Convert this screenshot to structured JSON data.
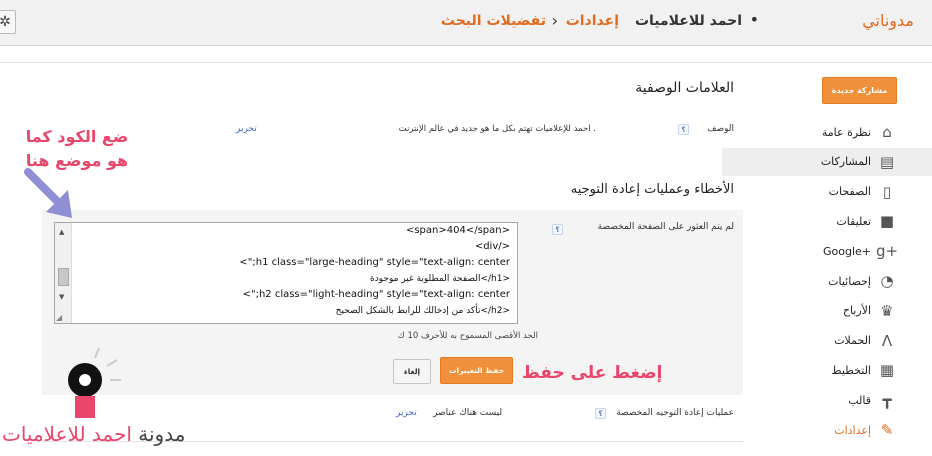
{
  "topbar": {
    "blog_name": "مدوناتي",
    "breadcrumb_blog": "احمد للاعلاميات",
    "breadcrumb_dot": "•",
    "breadcrumb_settings": "إعدادات",
    "breadcrumb_sep": "›",
    "breadcrumb_page": "تفضيلات البحث",
    "gear_icon": "gear-icon"
  },
  "sidebar": {
    "new_post": "مشاركة جديدة",
    "items": [
      {
        "label": "نظرة عامة",
        "icon": "home-icon",
        "glyph": "⌂"
      },
      {
        "label": "المشاركات",
        "icon": "document-icon",
        "glyph": "▤"
      },
      {
        "label": "الصفحات",
        "icon": "page-icon",
        "glyph": "▯"
      },
      {
        "label": "تعليقات",
        "icon": "comment-icon",
        "glyph": "■"
      },
      {
        "label": "Google+",
        "icon": "google-plus-icon",
        "glyph": "g+"
      },
      {
        "label": "إحصائيات",
        "icon": "pie-chart-icon",
        "glyph": "◔"
      },
      {
        "label": "الأرباح",
        "icon": "trophy-icon",
        "glyph": "♛"
      },
      {
        "label": "الحملات",
        "icon": "ads-icon",
        "glyph": "Λ"
      },
      {
        "label": "التخطيط",
        "icon": "layout-icon",
        "glyph": "▦"
      },
      {
        "label": "قالب",
        "icon": "paint-roller-icon",
        "glyph": "┳"
      },
      {
        "label": "إعدادات",
        "icon": "wrench-icon",
        "glyph": "✎"
      }
    ]
  },
  "main": {
    "meta_title": "العلامات الوصفية",
    "description_label": "الوصف",
    "help_mark": "؟",
    "description_text": "احمد للإعلاميات تهتم بكل ما هو جديد في عالم الإنترنت .",
    "edit_label": "تحرير",
    "errors_title": "الأخطاء وعمليات إعادة التوجيه",
    "notfound_label": "لم يتم العثور على الصفحة المخصصة",
    "code_lines": [
      "<span>404</span>",
      "<div/>",
      "<\";h1 class=\"large-heading\" style=\"text-align: center",
      "الصفحة المطلوبة غير موجودة</h1>",
      "<\";h2 class=\"light-heading\" style=\"text-align: center",
      "تأكد من إدخالك للرابط بالشكل الصحيح</h2>"
    ],
    "max_chars": "الحد الأقصى المسموح به للأحرف 10 ك",
    "save_button": "حفظ التغييرات",
    "cancel_button": "إلغاء",
    "redirect_label": "عمليات إعادة التوجيه المخصصة",
    "redirect_value": "ليست هناك عناصر",
    "redirect_edit": "تحرير"
  },
  "annotations": {
    "code_hint": "ضع الكود كما هو موضع هنا",
    "save_hint": "إضغط على حفظ",
    "brand_prefix": "مدونة",
    "brand_highlight": "احمد للاعلاميات"
  },
  "colors": {
    "accent": "#e26b20",
    "button": "#f0903a",
    "annotation": "#e8466a",
    "arrow": "#8f8fd6"
  }
}
